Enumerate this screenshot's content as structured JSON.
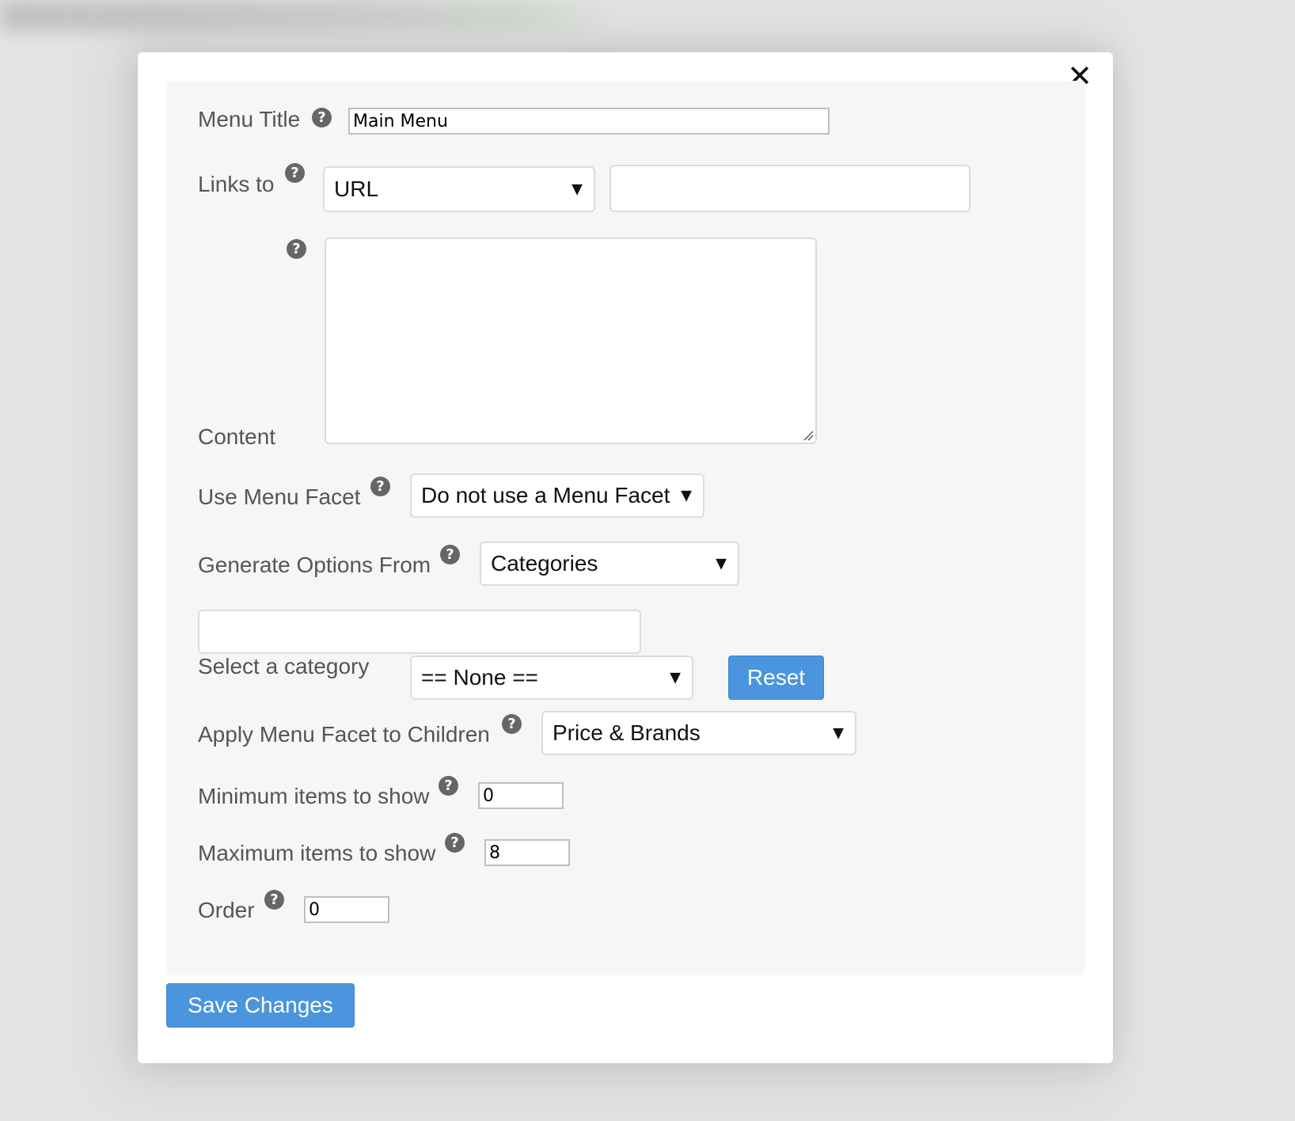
{
  "modal": {
    "close_glyph": "✕",
    "fields": {
      "menu_title": {
        "label": "Menu Title",
        "value": "Main Menu"
      },
      "links_to": {
        "label": "Links to",
        "selected": "URL",
        "url_value": ""
      },
      "content": {
        "label": "Content",
        "value": ""
      },
      "use_menu_facet": {
        "label": "Use Menu Facet",
        "selected": "Do not use a Menu Facet"
      },
      "generate_options_from": {
        "label": "Generate Options From",
        "selected": "Categories"
      },
      "category_search": {
        "value": ""
      },
      "select_category": {
        "label": "Select a category",
        "selected": "== None ==",
        "reset_label": "Reset"
      },
      "apply_menu_facet": {
        "label": "Apply Menu Facet to Children",
        "selected": "Price & Brands"
      },
      "min_items": {
        "label": "Minimum items to show",
        "value": "0"
      },
      "max_items": {
        "label": "Maximum items to show",
        "value": "8"
      },
      "order": {
        "label": "Order",
        "value": "0"
      }
    },
    "help_glyph": "?",
    "caret_glyph": "▼",
    "save_label": "Save Changes"
  },
  "colors": {
    "primary_button": "#4a95dd",
    "panel_background": "#f6f6f6",
    "label_text": "#555555"
  },
  "icons": [
    "close-icon",
    "help-icon",
    "chevron-down-icon",
    "resize-grip-icon"
  ]
}
